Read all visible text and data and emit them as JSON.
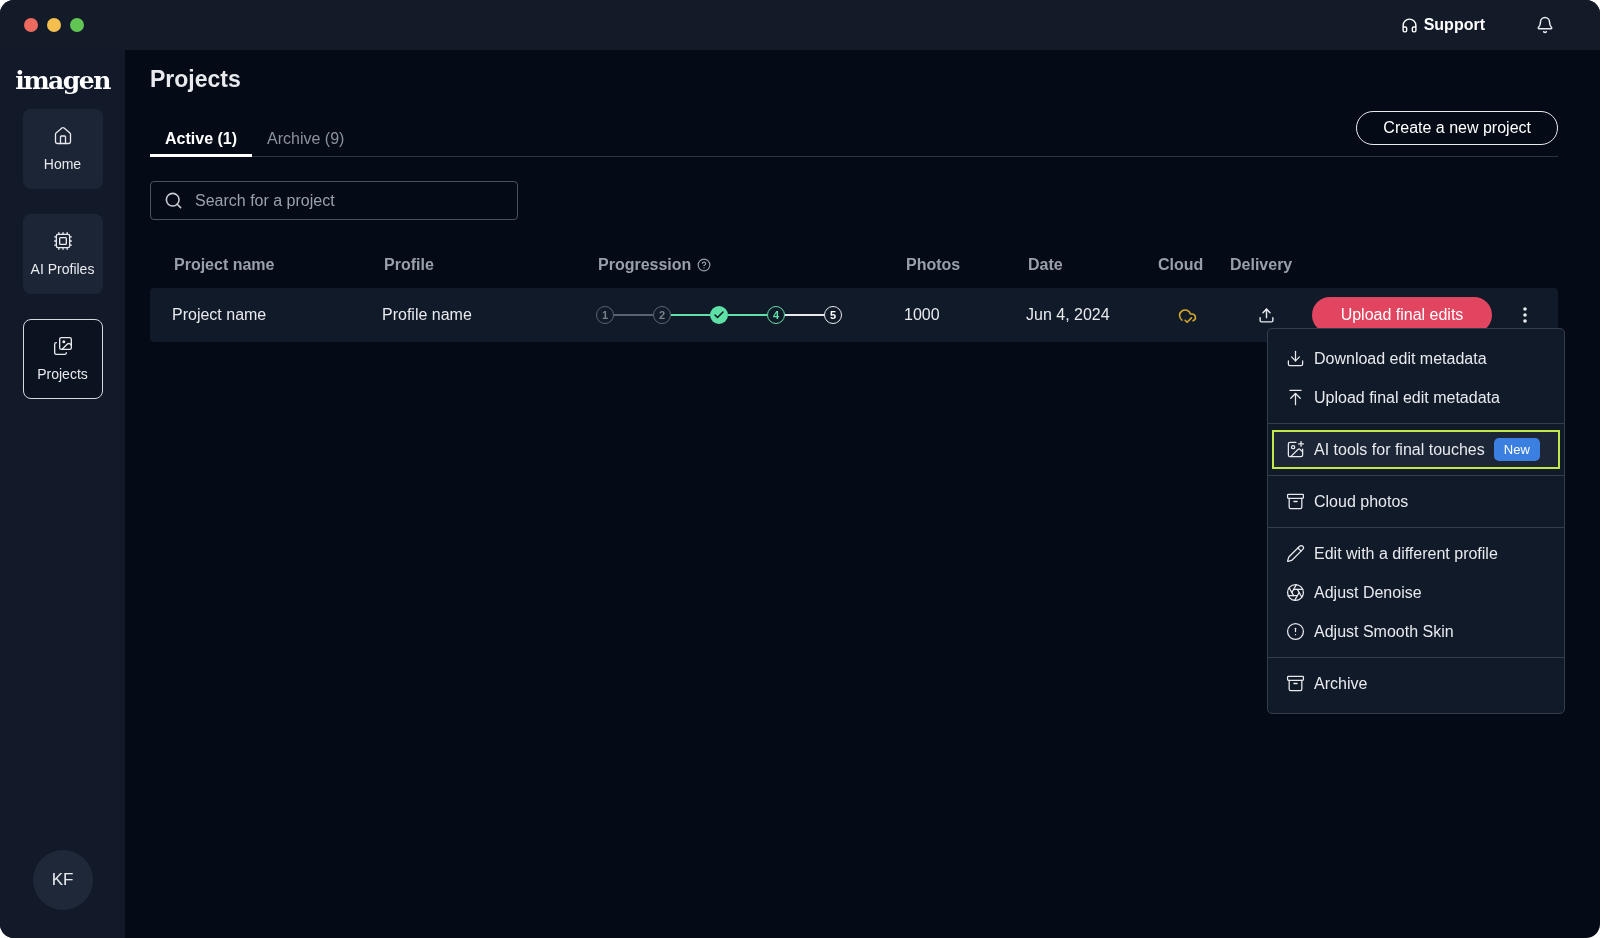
{
  "window": {
    "controls": [
      {
        "color": "#ec6a5e"
      },
      {
        "color": "#f4bf4f"
      },
      {
        "color": "#61c554"
      }
    ]
  },
  "top_bar": {
    "support": "Support"
  },
  "sidebar": {
    "logo": "imagen",
    "items": [
      {
        "label": "Home",
        "kind": "home",
        "selected": false
      },
      {
        "label": "AI Profiles",
        "kind": "chip",
        "selected": false
      },
      {
        "label": "Projects",
        "kind": "picture",
        "selected": true
      }
    ],
    "avatar": "KF"
  },
  "page": {
    "title": "Projects",
    "tabs": [
      {
        "label": "Active (1)",
        "selected": true
      },
      {
        "label": "Archive (9)",
        "selected": false
      }
    ],
    "create_button": "Create a new project",
    "search": {
      "placeholder": "Search for a project"
    }
  },
  "table": {
    "columns": [
      "Project name",
      "Profile",
      "Progression",
      "Photos",
      "Date",
      "Cloud",
      "Delivery"
    ],
    "rows": [
      {
        "project_name": "Project name",
        "profile": "Profile name",
        "steps": [
          {
            "label": "1",
            "kind": "pending"
          },
          {
            "label": "2",
            "kind": "pending"
          },
          {
            "kind": "done"
          },
          {
            "label": "4",
            "kind": "active"
          },
          {
            "label": "5",
            "kind": "upcoming"
          }
        ],
        "photos": "1000",
        "date": "Jun 4, 2024",
        "action": "Upload final edits"
      }
    ]
  },
  "menu": {
    "groups": [
      [
        {
          "label": "Download edit metadata",
          "kind": "download",
          "highlighted": false
        },
        {
          "label": "Upload final edit metadata",
          "kind": "upload",
          "highlighted": false
        }
      ],
      [
        {
          "label": "AI tools for final touches",
          "kind": "ai",
          "highlighted": true,
          "badge": "New"
        }
      ],
      [
        {
          "label": "Cloud photos",
          "kind": "archive",
          "highlighted": false
        }
      ],
      [
        {
          "label": "Edit with a different profile",
          "kind": "pencil",
          "highlighted": false
        },
        {
          "label": "Adjust Denoise",
          "kind": "denoise",
          "highlighted": false
        },
        {
          "label": "Adjust Smooth Skin",
          "kind": "skin",
          "highlighted": false
        }
      ],
      [
        {
          "label": "Archive",
          "kind": "archive",
          "highlighted": false
        }
      ]
    ]
  }
}
